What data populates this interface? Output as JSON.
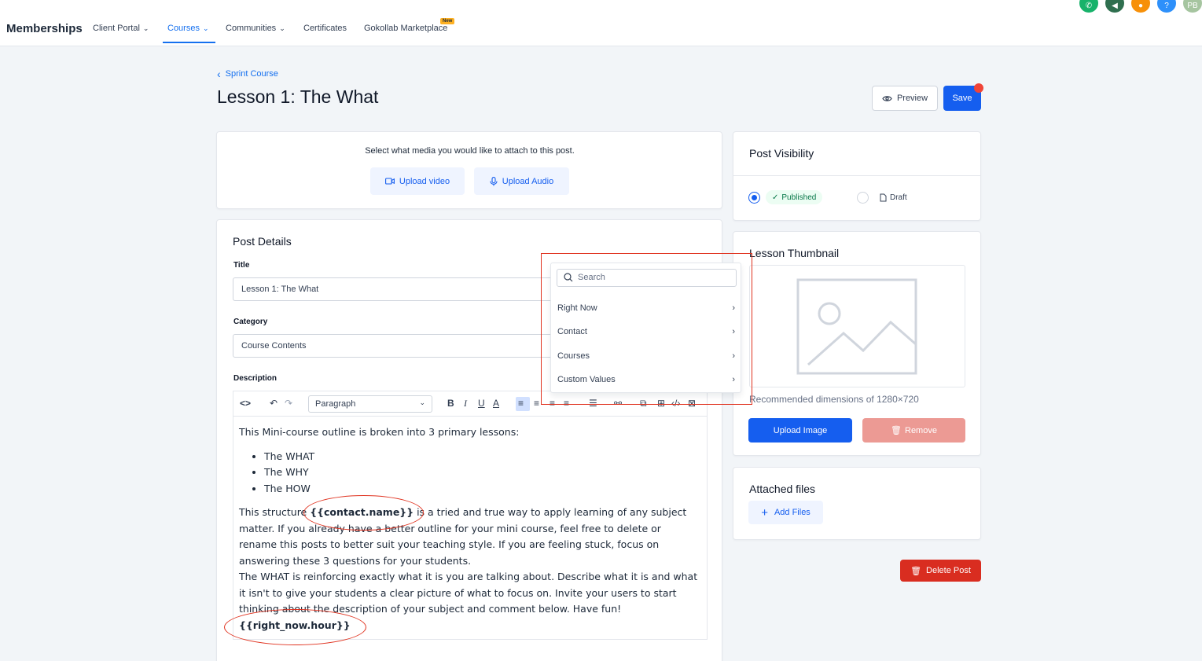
{
  "nav": {
    "brand": "Memberships",
    "items": [
      {
        "label": "Client Portal",
        "has_dropdown": true
      },
      {
        "label": "Courses",
        "has_dropdown": true,
        "active": true
      },
      {
        "label": "Communities",
        "has_dropdown": true
      },
      {
        "label": "Certificates",
        "has_dropdown": false
      },
      {
        "label": "Gokollab Marketplace",
        "has_dropdown": false
      }
    ],
    "new_badge": "New",
    "avatar_initials": "PB"
  },
  "header": {
    "back_label": "Sprint Course",
    "title": "Lesson 1: The What",
    "preview_label": "Preview",
    "save_label": "Save"
  },
  "media": {
    "prompt": "Select what media you would like to attach to this post.",
    "upload_video": "Upload video",
    "upload_audio": "Upload Audio"
  },
  "post_details": {
    "heading": "Post Details",
    "title_label": "Title",
    "title_value": "Lesson 1: The What",
    "category_label": "Category",
    "category_value": "Course Contents",
    "description_label": "Description",
    "block_format": "Paragraph",
    "body": {
      "intro": "This Mini-course outline is broken into 3 primary lessons:",
      "bullets": [
        "The WHAT",
        "The WHY",
        "The HOW"
      ],
      "p1_before": "This structure ",
      "p1_token": "{{contact.name}}",
      "p1_after": " is a tried and true way to apply learning of any subject matter. If you already have a better outline for your mini course, feel free to delete or rename this posts to better suit your teaching style. If you are feeling stuck, focus on answering these 3 questions for your students.",
      "p2": "The WHAT is reinforcing exactly what it is you are talking about. Describe what it is and what it isn't to give your students a clear picture of what to focus on. Invite your users to start thinking about the description of your subject and comment below. Have fun!",
      "p3_token": "{{right_now.hour}}"
    }
  },
  "merge_dropdown": {
    "search_placeholder": "Search",
    "items": [
      "Right Now",
      "Contact",
      "Courses",
      "Custom Values"
    ]
  },
  "visibility": {
    "heading": "Post Visibility",
    "published": "Published",
    "draft": "Draft",
    "selected": "Published"
  },
  "thumbnail": {
    "heading": "Lesson Thumbnail",
    "hint": "Recommended dimensions of 1280×720",
    "upload_label": "Upload Image",
    "remove_label": "Remove"
  },
  "files": {
    "heading": "Attached files",
    "add_label": "Add Files"
  },
  "delete_label": "Delete Post",
  "colors": {
    "primary": "#155eef",
    "danger": "#d92d20",
    "annotation": "#e0321f"
  }
}
